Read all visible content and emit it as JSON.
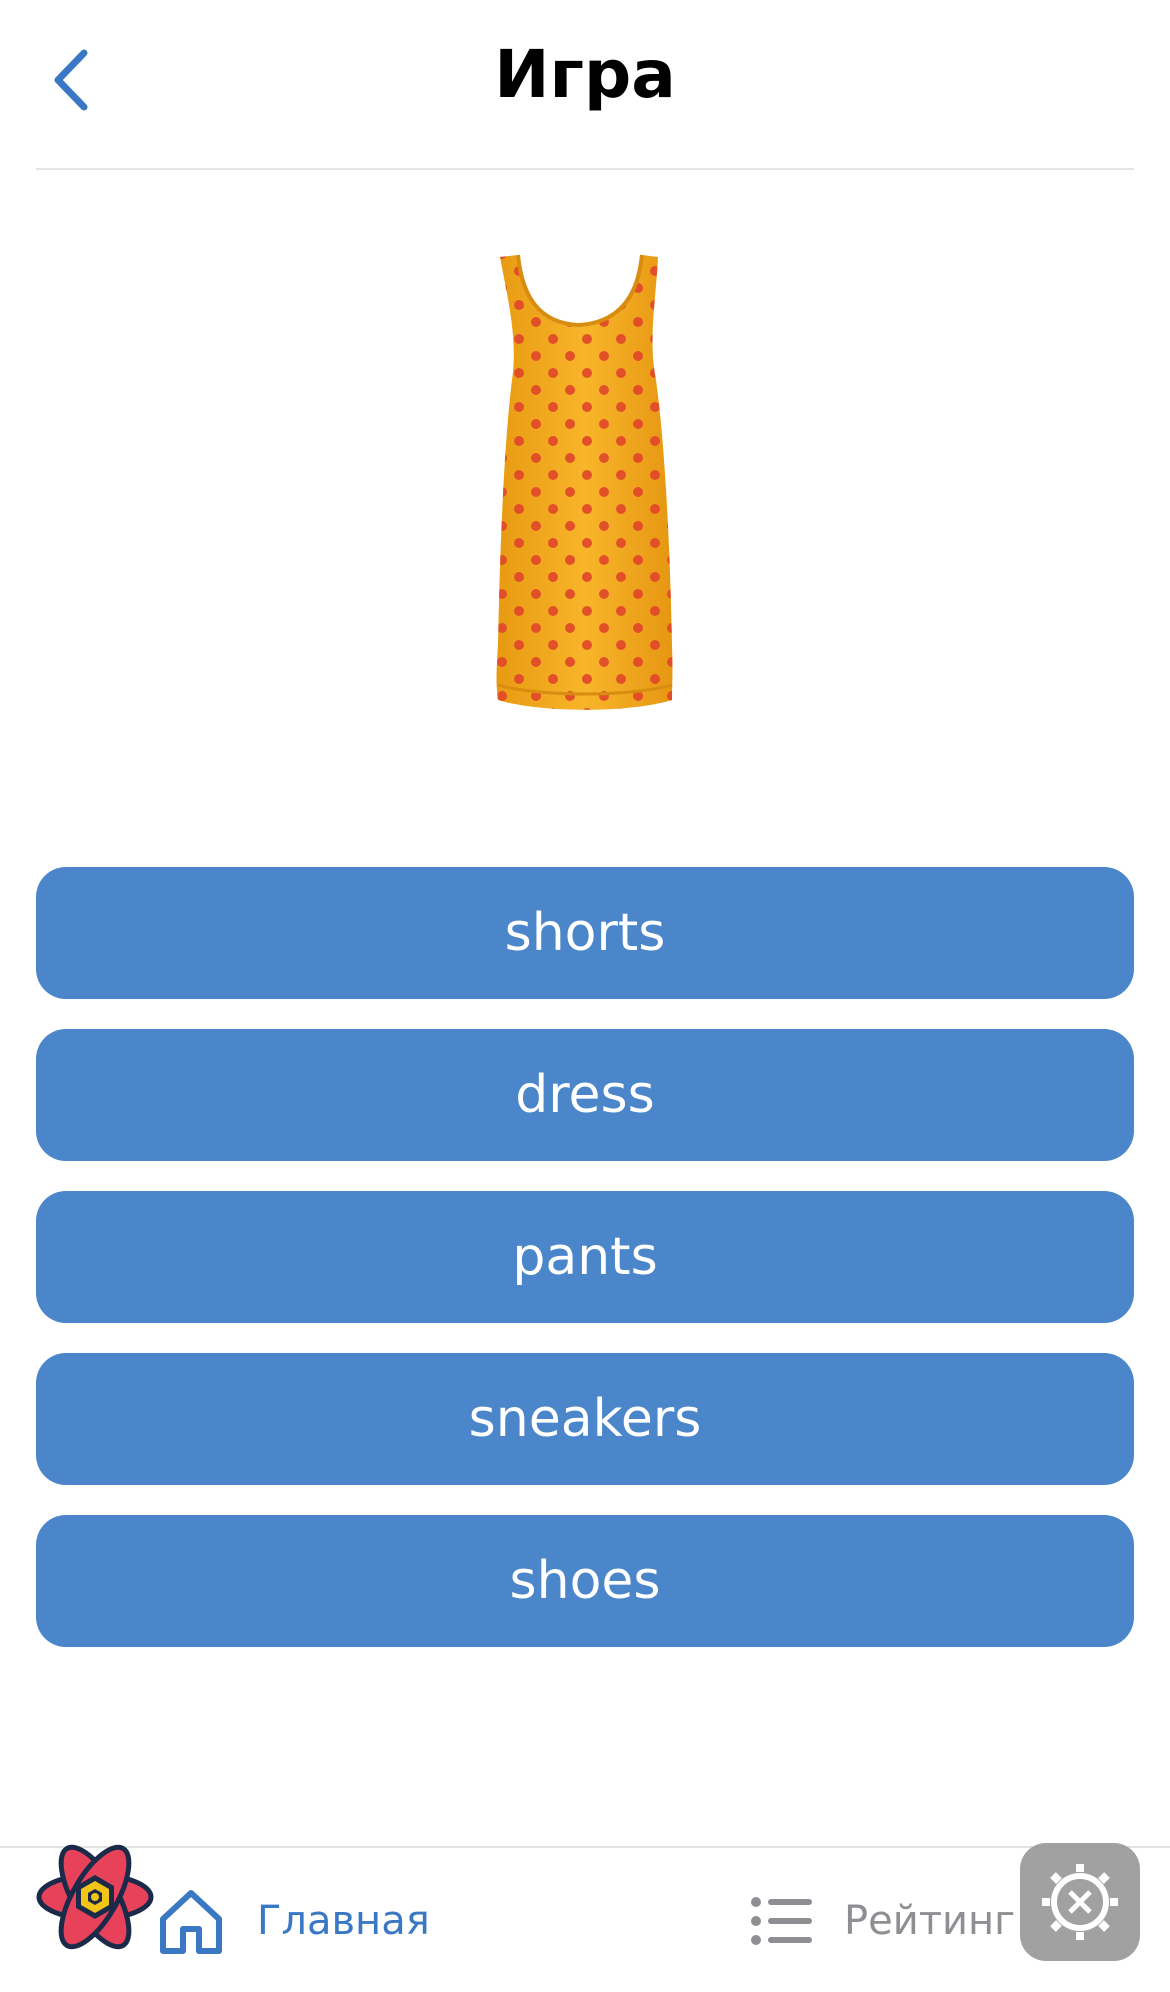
{
  "header": {
    "title": "Игра"
  },
  "question": {
    "image": "yellow-dress-with-red-dots"
  },
  "answers": [
    {
      "label": "shorts"
    },
    {
      "label": "dress"
    },
    {
      "label": "pants"
    },
    {
      "label": "sneakers"
    },
    {
      "label": "shoes"
    }
  ],
  "tabbar": {
    "home_label": "Главная",
    "rating_label": "Рейтинг",
    "active_tab": "home"
  },
  "colors": {
    "accent": "#4a86c9",
    "active_tab": "#3a78c4",
    "inactive_tab": "#8e8e93"
  }
}
